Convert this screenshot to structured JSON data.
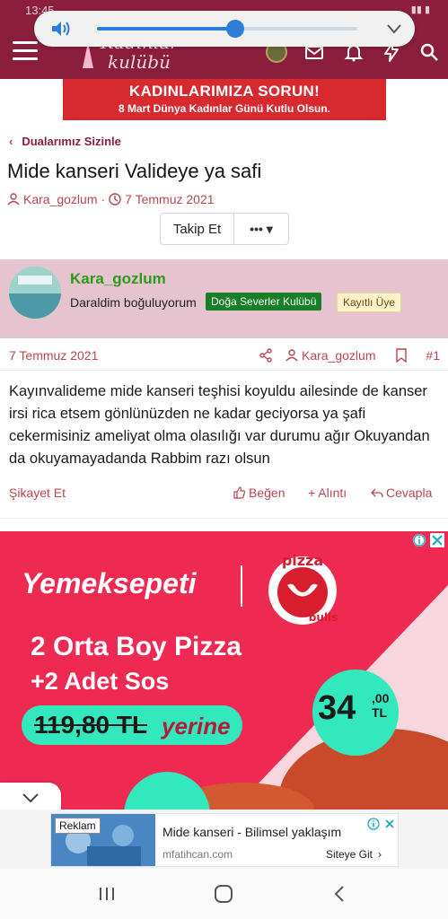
{
  "status": {
    "time": "13:45"
  },
  "header": {
    "logo_line1": "Kadınlar",
    "logo_line2": "kulübü"
  },
  "volume": {
    "level": 0.53
  },
  "banner": {
    "line1": "KADINLARIMIZA SORUN!",
    "line2": "8 Mart Dünya Kadınlar Günü Kutlu Olsun."
  },
  "breadcrumb": {
    "label": "Dualarımız Sizinle"
  },
  "thread": {
    "title": "Mide kanseri Valideye ya safi",
    "author": "Kara_gozlum",
    "date": "7 Temmuz 2021",
    "follow_label": "Takip Et",
    "more_label": "•••"
  },
  "post": {
    "username": "Kara_gozlum",
    "user_title": "Daraldim boğuluyorum",
    "badge_group": "Doğa Severler Kulübü",
    "badge_role": "Kayıtlı Üye",
    "date": "7 Temmuz 2021",
    "author": "Kara_gozlum",
    "number": "#1",
    "body": "Kayınvalideme mide kanseri teşhisi koyuldu ailesinde de kanser irsi rica etsem gönlünüzden ne kadar geciyorsa ya şafi cekermisiniz ameliyat olma olasılığı var durumu ağır Okuyandan da okuyamayadanda Rabbim razı olsun",
    "report_label": "Şikayet Et",
    "like_label": "Beğen",
    "quote_label": "+ Alıntı",
    "reply_label": "Cevapla"
  },
  "ad": {
    "brand": "Yemeksepeti",
    "partner_line1": "pizza",
    "partner_line2": "bulls",
    "line1": "2 Orta Boy Pizza",
    "line2": "+2 Adet Sos",
    "old_price": "119,80 TL",
    "instead": "yerine",
    "new_price": "34",
    "new_price_cents": ",00",
    "currency": "TL",
    "colors": {
      "bg": "#ee2a52",
      "accent": "#33e8bc"
    }
  },
  "bottom_ad": {
    "tag": "Reklam",
    "title": "Mide kanseri - Bilimsel yaklaşım",
    "site": "mfatihcan.com",
    "cta": "Siteye Git"
  },
  "icons": [
    "volume-icon",
    "chevron-down-icon",
    "menu-icon",
    "mail-icon",
    "bell-icon",
    "bolt-icon",
    "search-icon",
    "user-icon",
    "clock-icon",
    "share-icon",
    "bookmark-icon",
    "thumbs-up-icon",
    "reply-icon",
    "info-icon",
    "close-icon",
    "recents-icon",
    "home-icon",
    "back-icon"
  ]
}
